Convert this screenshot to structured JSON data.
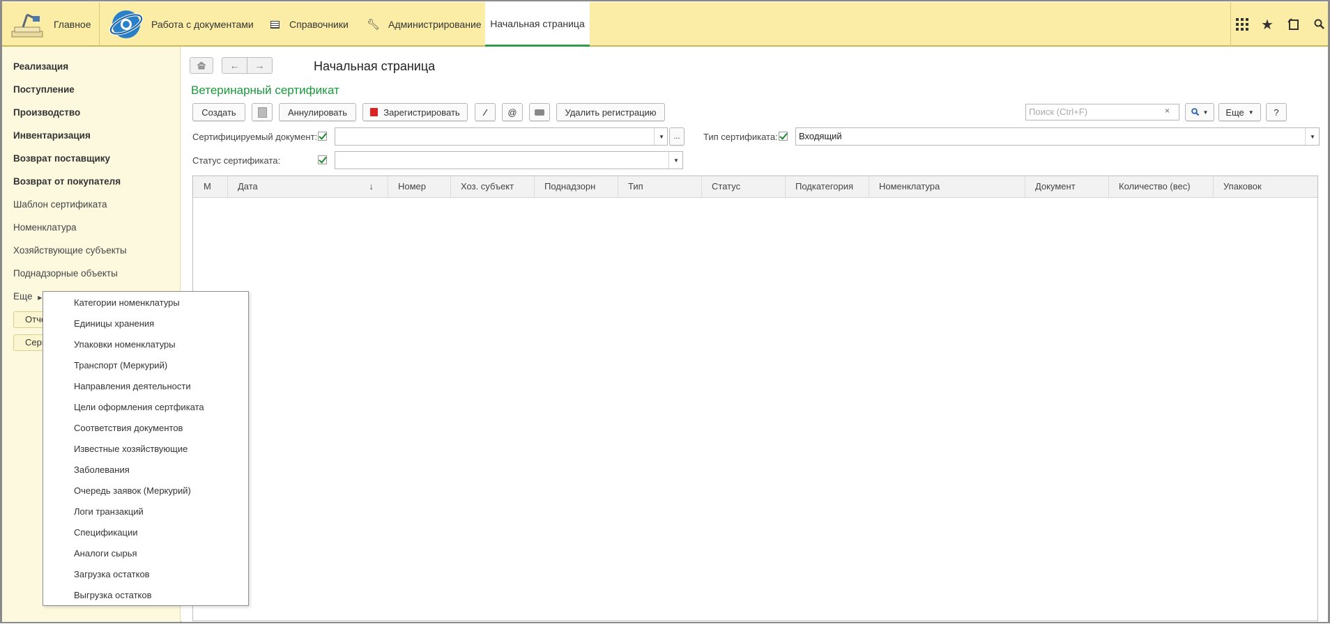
{
  "topbar": {
    "main_label": "Главное",
    "docs_label": "Работа с документами",
    "refs_label": "Справочники",
    "admin_label": "Администрирование",
    "home_tab_label": "Начальная страница"
  },
  "sidebar": {
    "bold_items": [
      "Реализация",
      "Поступление",
      "Производство",
      "Инвентаризация",
      "Возврат поставщику",
      "Возврат от покупателя"
    ],
    "items": [
      "Шаблон сертификата",
      "Номенклатура",
      "Хозяйствующие субъекты",
      "Поднадзорные объекты"
    ],
    "more_label": "Еще",
    "reports_label": "Отче",
    "service_label": "Серв"
  },
  "page": {
    "title": "Начальная страница",
    "section_title": "Ветеринарный сертификат"
  },
  "toolbar": {
    "create": "Создать",
    "annul": "Аннулировать",
    "register": "Зарегистрировать",
    "at_symbol": "@",
    "delete_registration": "Удалить регистрацию",
    "search_placeholder": "Поиск (Ctrl+F)",
    "search_clear": "×",
    "more": "Еще",
    "help": "?"
  },
  "filters": {
    "cert_doc_label": "Сертифицируемый документ:",
    "cert_doc_value": "",
    "cert_doc_dots": "...",
    "cert_type_label": "Тип сертификата:",
    "cert_type_value": "Входящий",
    "cert_status_label": "Статус сертификата:",
    "cert_status_value": ""
  },
  "table": {
    "columns": [
      "М",
      "Дата",
      "Номер",
      "Хоз. субъект",
      "Поднадзорн",
      "Тип",
      "Статус",
      "Подкатегория",
      "Номенклатура",
      "Документ",
      "Количество (вес)",
      "Упаковок"
    ],
    "sort_indicator": "↓"
  },
  "popup": {
    "items": [
      "Категории номенклатуры",
      "Единицы хранения",
      "Упаковки номенклатуры",
      "Транспорт (Меркурий)",
      "Направления деятельности",
      "Цели оформления сертфиката",
      "Соответствия документов",
      "Известные хозяйствующие",
      "Заболевания",
      "Очередь заявок (Меркурий)",
      "Логи транзакций",
      "Спецификации",
      "Аналоги сырья",
      "Загрузка остатков",
      "Выгрузка остатков"
    ]
  },
  "colors": {
    "topbar_bg": "#fbeda6",
    "sidebar_bg": "#fcf9de",
    "section_title": "#1a9a3a",
    "active_tab_underline": "#2e9e4b"
  }
}
